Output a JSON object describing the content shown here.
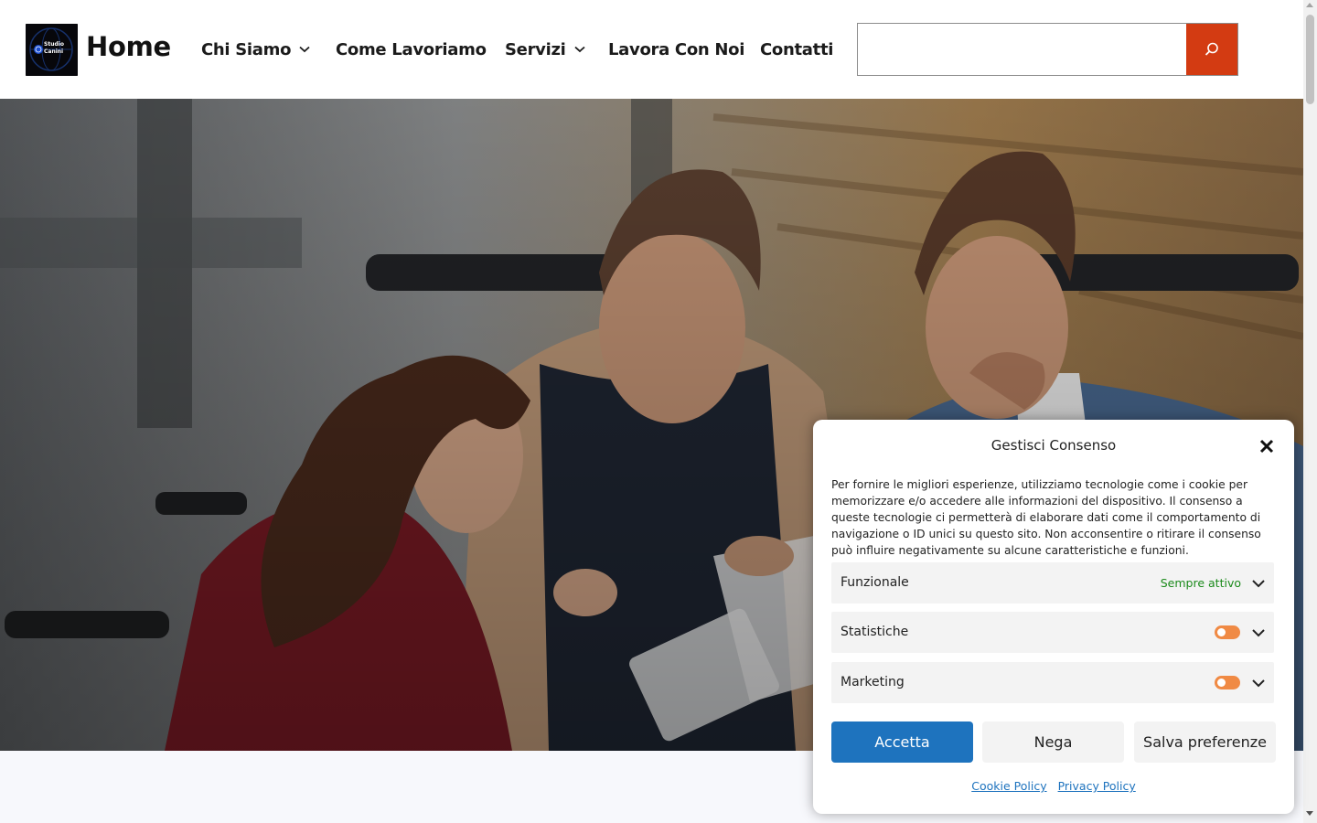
{
  "header": {
    "logo_text_line1": "Studio",
    "logo_text_line2": "Canini",
    "site_title": "Home",
    "nav": [
      {
        "label": "Chi Siamo",
        "has_dropdown": true
      },
      {
        "label": "Come Lavoriamo",
        "has_dropdown": false
      },
      {
        "label": "Servizi",
        "has_dropdown": true
      },
      {
        "label": "Lavora Con Noi",
        "has_dropdown": false
      },
      {
        "label": "Contatti",
        "has_dropdown": false
      }
    ],
    "search": {
      "value": "",
      "placeholder": ""
    },
    "search_icon": "search-icon"
  },
  "colors": {
    "accent": "#d33b12",
    "primary_button": "#1e73be",
    "toggle": "#f08a44",
    "always_active": "#1b8a1b"
  },
  "consent": {
    "title": "Gestisci Consenso",
    "text": "Per fornire le migliori esperienze, utilizziamo tecnologie come i cookie per memorizzare e/o accedere alle informazioni del dispositivo. Il consenso a queste tecnologie ci permetterà di elaborare dati come il comportamento di navigazione o ID unici su questo sito. Non acconsentire o ritirare il consenso può influire negativamente su alcune caratteristiche e funzioni.",
    "categories": [
      {
        "label": "Funzionale",
        "status": "Sempre attivo"
      },
      {
        "label": "Statistiche",
        "status": ""
      },
      {
        "label": "Marketing",
        "status": ""
      }
    ],
    "buttons": {
      "accept": "Accetta",
      "deny": "Nega",
      "save": "Salva preferenze"
    },
    "links": {
      "cookie_policy": "Cookie Policy",
      "privacy_policy": "Privacy Policy"
    }
  }
}
